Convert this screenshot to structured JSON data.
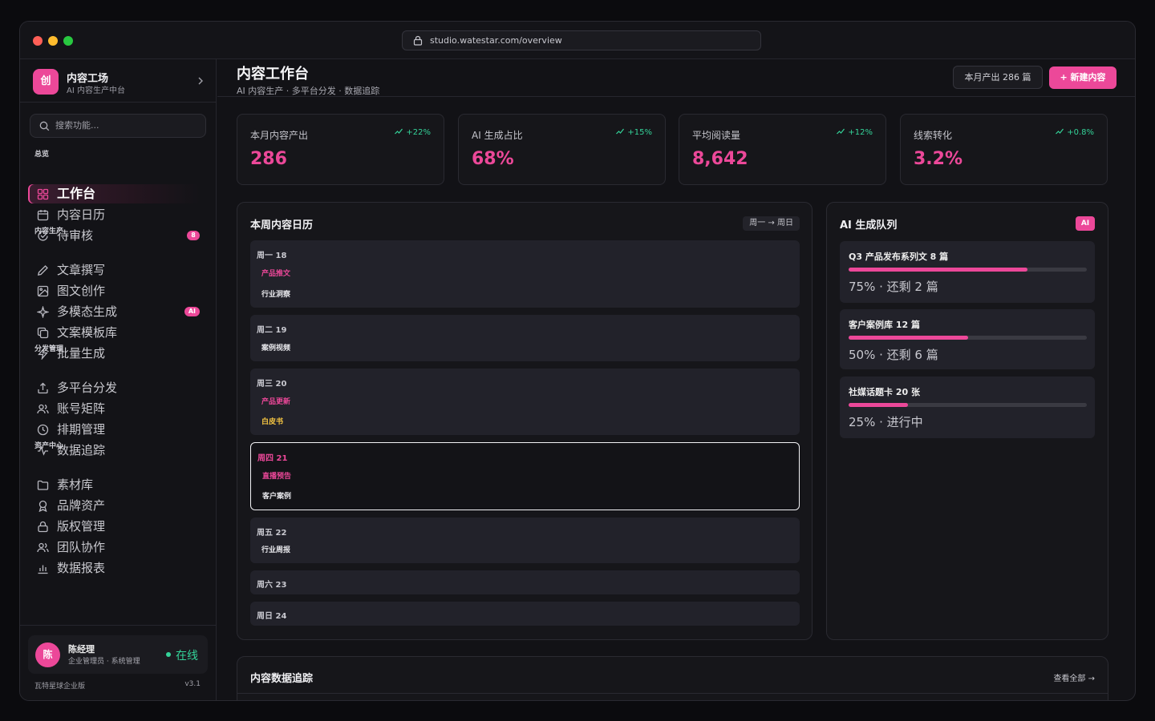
{
  "browser": {
    "url": "studio.watestar.com/overview"
  },
  "sidebar": {
    "brand": {
      "logo_text": "创",
      "name": "内容工场",
      "subtitle": "AI 内容生产中台"
    },
    "search_placeholder": "搜索功能...",
    "sections": {
      "overview": "总览",
      "production": "内容生产",
      "distribution": "分发管理",
      "assets": "资产中心"
    },
    "items": [
      {
        "label": "工作台",
        "icon": "grid-icon",
        "active": true
      },
      {
        "label": "内容日历",
        "icon": "calendar-icon"
      },
      {
        "label": "待审核",
        "icon": "check-circle-icon",
        "badge": "8"
      },
      {
        "label": "文章撰写",
        "icon": "pen-icon"
      },
      {
        "label": "图文创作",
        "icon": "image-icon"
      },
      {
        "label": "多模态生成",
        "icon": "sparkle-icon",
        "badge": "AI"
      },
      {
        "label": "文案模板库",
        "icon": "copy-icon"
      },
      {
        "label": "批量生成",
        "icon": "bolt-icon"
      },
      {
        "label": "多平台分发",
        "icon": "share-icon"
      },
      {
        "label": "账号矩阵",
        "icon": "users-icon"
      },
      {
        "label": "排期管理",
        "icon": "clock-icon"
      },
      {
        "label": "数据追踪",
        "icon": "activity-icon"
      },
      {
        "label": "素材库",
        "icon": "folder-icon"
      },
      {
        "label": "品牌资产",
        "icon": "award-icon"
      },
      {
        "label": "版权管理",
        "icon": "lock-icon"
      },
      {
        "label": "团队协作",
        "icon": "team-icon"
      },
      {
        "label": "数据报表",
        "icon": "bar-chart-icon"
      }
    ],
    "user": {
      "avatar_text": "陈",
      "name": "陈经理",
      "role": "企业管理员 · 系统管理",
      "status": "在线"
    },
    "edition": "瓦特星球企业版",
    "version": "v3.1"
  },
  "header": {
    "title": "内容工作台",
    "subtitle": "AI 内容生产 · 多平台分发 · 数据追踪",
    "count_button": "本月产出 286 篇",
    "new_button": "+ 新建内容"
  },
  "stats": [
    {
      "label": "本月内容产出",
      "delta": "+22%",
      "value": "286"
    },
    {
      "label": "AI 生成占比",
      "delta": "+15%",
      "value": "68%"
    },
    {
      "label": "平均阅读量",
      "delta": "+12%",
      "value": "8,642"
    },
    {
      "label": "线索转化",
      "delta": "+0.8%",
      "value": "3.2%"
    }
  ],
  "calendar": {
    "title": "本周内容日历",
    "range": "周一 → 周日",
    "days": [
      {
        "label": "周一 18",
        "items": [
          {
            "text": "产品推文",
            "color": "#ec4899"
          },
          {
            "text": "行业洞察",
            "color": "#e6e6ea"
          }
        ]
      },
      {
        "label": "周二 19",
        "items": [
          {
            "text": "案例视频",
            "color": "#e6e6ea"
          }
        ]
      },
      {
        "label": "周三 20",
        "items": [
          {
            "text": "产品更新",
            "color": "#ec4899"
          },
          {
            "text": "白皮书",
            "color": "#f5c542"
          }
        ]
      },
      {
        "label": "周四 21",
        "active": true,
        "items": [
          {
            "text": "直播预告",
            "color": "#ec4899"
          },
          {
            "text": "客户案例",
            "color": "#e6e6ea"
          }
        ]
      },
      {
        "label": "周五 22",
        "items": [
          {
            "text": "行业周报",
            "color": "#e6e6ea"
          }
        ]
      },
      {
        "label": "周六 23",
        "items": []
      },
      {
        "label": "周日 24",
        "items": []
      }
    ]
  },
  "ai_queue": {
    "title": "AI 生成队列",
    "chip": "AI",
    "items": [
      {
        "title": "Q3 产品发布系列文 8 篇",
        "progress": 0.75,
        "status": "75% · 还剩 2 篇"
      },
      {
        "title": "客户案例库 12 篇",
        "progress": 0.5,
        "status": "50% · 还剩 6 篇"
      },
      {
        "title": "社媒话题卡 20 张",
        "progress": 0.25,
        "status": "25% · 进行中"
      }
    ]
  },
  "tracking": {
    "title": "内容数据追踪",
    "view_all": "查看全部 →"
  },
  "colors": {
    "accent": "#ec4899",
    "positive": "#34d399",
    "background": "#121216"
  }
}
